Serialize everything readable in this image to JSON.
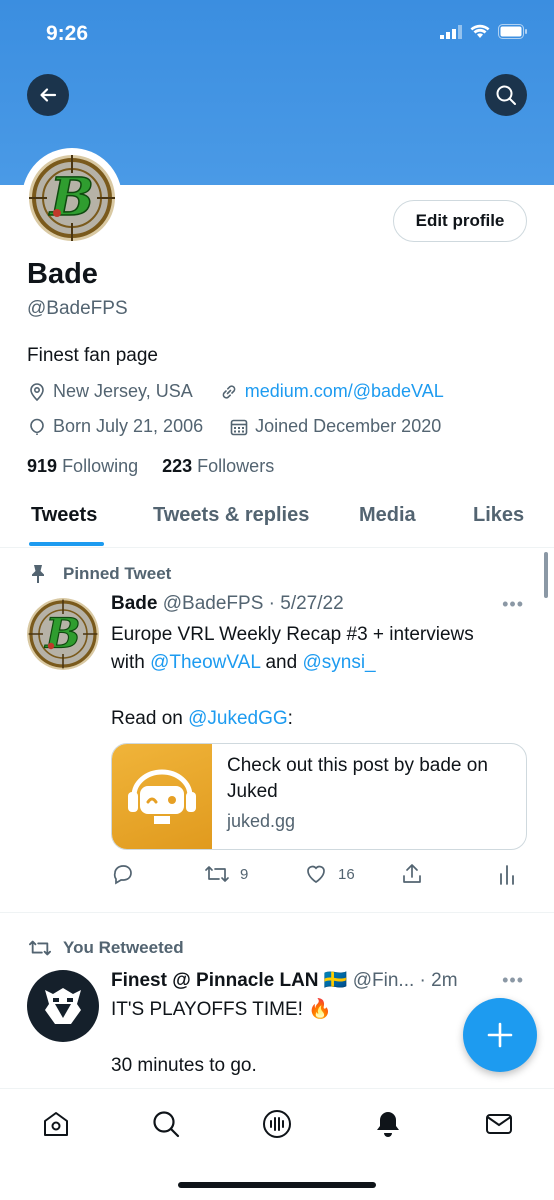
{
  "status_bar": {
    "time": "9:26"
  },
  "profile": {
    "name": "Bade",
    "handle": "@BadeFPS",
    "bio": "Finest fan page",
    "location": "New Jersey, USA",
    "website": "medium.com/@badeVAL",
    "birthday": "Born July 21, 2006",
    "joined": "Joined December 2020",
    "following_count": "919",
    "following_label": "Following",
    "followers_count": "223",
    "followers_label": "Followers",
    "edit_label": "Edit profile"
  },
  "tabs": [
    {
      "label": "Tweets"
    },
    {
      "label": "Tweets & replies"
    },
    {
      "label": "Media"
    },
    {
      "label": "Likes"
    }
  ],
  "pinned_tweet": {
    "label": "Pinned Tweet",
    "author": "Bade",
    "meta": "@BadeFPS · 5/27/22",
    "line1": "Europe VRL Weekly Recap #3 + interviews",
    "with": "with",
    "mention1": "@TheowVAL",
    "and": "and",
    "mention2": "@synsi_",
    "read_on": "Read on",
    "mention3": "@JukedGG",
    "colon": ":",
    "card": {
      "title": "Check out this post by bade on Juked",
      "domain": "juked.gg"
    },
    "retweets": "9",
    "likes": "16"
  },
  "retweet": {
    "label": "You Retweeted",
    "author": "Finest @ Pinnacle LAN 🇸🇪",
    "meta": "@Fin... · 2m",
    "line1": "IT'S PLAYOFFS TIME! 🔥",
    "line2": "30 minutes to go."
  },
  "colors": {
    "accent": "#1d9bf0",
    "banner": "#4a9ae6",
    "text": "#0f1419",
    "secondary": "#536471"
  },
  "icons": {
    "back": "arrow-left-icon",
    "search": "search-icon",
    "location": "location-icon",
    "link": "link-icon",
    "birthday": "balloon-icon",
    "calendar": "calendar-icon",
    "pin": "pin-icon",
    "reply": "reply-icon",
    "retweet": "retweet-icon",
    "like": "heart-icon",
    "share": "share-icon",
    "analytics": "analytics-icon",
    "compose": "plus-icon",
    "nav": [
      "home-icon",
      "search-icon",
      "spaces-icon",
      "notifications-icon",
      "messages-icon"
    ]
  }
}
